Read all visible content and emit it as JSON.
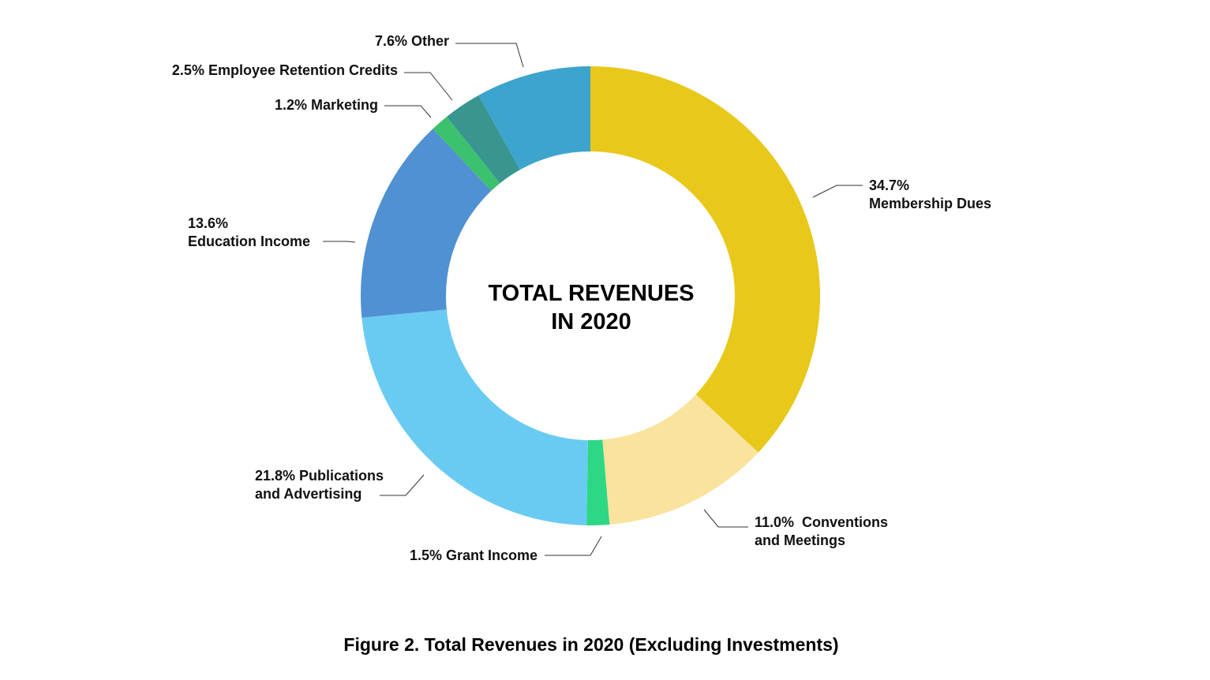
{
  "chart_data": {
    "type": "pie",
    "variant": "donut",
    "center_title": [
      "TOTAL REVENUES",
      "IN 2020"
    ],
    "caption": "Figure 2. Total Revenues in 2020 (Excluding Investments)",
    "unit": "%",
    "slices": [
      {
        "name": "Membership Dues",
        "value": 34.7,
        "color": "#E8C81A",
        "label_lines": [
          "34.7%",
          "Membership Dues"
        ]
      },
      {
        "name": "Conventions and Meetings",
        "value": 11.0,
        "color": "#FAE39C",
        "label_lines": [
          "11.0%  Conventions",
          "and Meetings"
        ]
      },
      {
        "name": "Grant Income",
        "value": 1.5,
        "color": "#2ED783",
        "label_lines": [
          "1.5% Grant Income"
        ]
      },
      {
        "name": "Publications and Advertising",
        "value": 21.8,
        "color": "#6ACBF2",
        "label_lines": [
          "21.8% Publications",
          "and Advertising"
        ]
      },
      {
        "name": "Education Income",
        "value": 13.6,
        "color": "#4F91D3",
        "label_lines": [
          "13.6%",
          "Education Income"
        ]
      },
      {
        "name": "Marketing",
        "value": 1.2,
        "color": "#3CC16E",
        "label_lines": [
          "1.2% Marketing"
        ]
      },
      {
        "name": "Employee Retention Credits",
        "value": 2.5,
        "color": "#389590",
        "label_lines": [
          "2.5% Employee Retention Credits"
        ]
      },
      {
        "name": "Other",
        "value": 7.6,
        "color": "#3DA4CE",
        "label_lines": [
          "7.6% Other"
        ]
      }
    ]
  }
}
